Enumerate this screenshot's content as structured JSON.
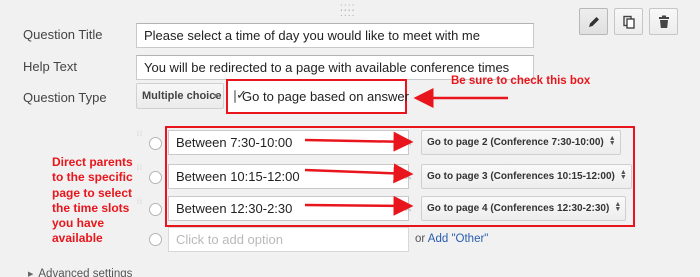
{
  "toolbar": {
    "edit_icon": "pencil-icon",
    "duplicate_icon": "duplicate-icon",
    "delete_icon": "trash-icon"
  },
  "form": {
    "title_label": "Question Title",
    "title_value": "Please select a time of day you would like to meet with me",
    "help_label": "Help Text",
    "help_value": "You will be redirected to a page with available conference times",
    "type_label": "Question Type",
    "type_value": "Multiple choice",
    "goto_label": "Go to page based on answer",
    "goto_checked": true
  },
  "options": [
    {
      "label": "Between 7:30-10:00",
      "target": "Go to page 2 (Conference 7:30-10:00)"
    },
    {
      "label": "Between 10:15-12:00",
      "target": "Go to page 3 (Conferences 10:15-12:00)"
    },
    {
      "label": "Between 12:30-2:30",
      "target": "Go to page 4 (Conferences 12:30-2:30)"
    }
  ],
  "add_option": {
    "placeholder": "Click to add option",
    "or_text": "or",
    "other_link": "Add \"Other\""
  },
  "advanced_label": "Advanced settings",
  "annotations": {
    "check_box_note": "Be sure to check this box",
    "parents_note": "Direct parents to the specific page to select the time slots you have available",
    "color": "#e8161c"
  }
}
